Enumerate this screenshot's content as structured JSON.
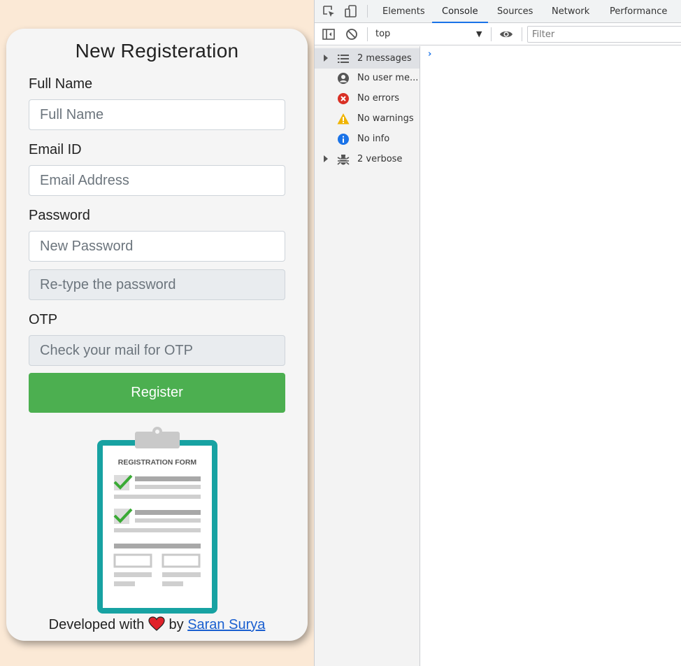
{
  "form": {
    "title": "New Registeration",
    "fullname_label": "Full Name",
    "fullname_placeholder": "Full Name",
    "email_label": "Email ID",
    "email_placeholder": "Email Address",
    "password_label": "Password",
    "password_placeholder": "New Password",
    "retype_placeholder": "Re-type the password",
    "otp_label": "OTP",
    "otp_placeholder": "Check your mail for OTP",
    "register_label": "Register",
    "illustration_caption": "REGISTRATION FORM"
  },
  "footer": {
    "prefix": "Developed with",
    "by": "by",
    "author": "Saran Surya"
  },
  "devtools": {
    "tabs": [
      "Elements",
      "Console",
      "Sources",
      "Network",
      "Performance"
    ],
    "active_tab": "Console",
    "context": "top",
    "filter_placeholder": "Filter",
    "sidebar": [
      {
        "label": "2 messages",
        "icon": "list-icon",
        "expandable": true,
        "selected": true
      },
      {
        "label": "No user me...",
        "icon": "user-icon",
        "expandable": false,
        "selected": false
      },
      {
        "label": "No errors",
        "icon": "error-icon",
        "expandable": false,
        "selected": false
      },
      {
        "label": "No warnings",
        "icon": "warning-icon",
        "expandable": false,
        "selected": false
      },
      {
        "label": "No info",
        "icon": "info-icon",
        "expandable": false,
        "selected": false
      },
      {
        "label": "2 verbose",
        "icon": "bug-icon",
        "expandable": true,
        "selected": false
      }
    ],
    "prompt": "›"
  },
  "colors": {
    "background": "#fbe9d6",
    "register_button": "#4caf50",
    "clipboard": "#17a2a2",
    "check": "#3aaa35",
    "heart": "#e0222a",
    "link": "#1a5fd0",
    "devtools_accent": "#1a73e8",
    "error": "#d93025",
    "warning": "#f0b400",
    "info": "#1a73e8"
  }
}
